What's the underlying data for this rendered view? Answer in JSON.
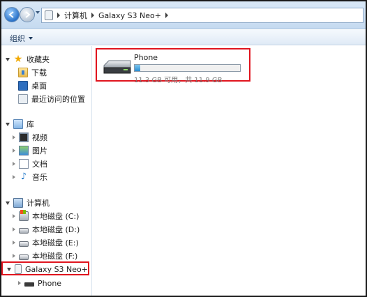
{
  "address_bar": {
    "crumbs": [
      "计算机",
      "Galaxy S3 Neo+"
    ]
  },
  "toolbar": {
    "organize_label": "组织"
  },
  "navpane": {
    "favorites": {
      "label": "收藏夹",
      "items": [
        "下载",
        "桌面",
        "最近访问的位置"
      ]
    },
    "libraries": {
      "label": "库",
      "items": [
        "视频",
        "图片",
        "文档",
        "音乐"
      ]
    },
    "computer": {
      "label": "计算机",
      "drives": [
        "本地磁盘 (C:)",
        "本地磁盘 (D:)",
        "本地磁盘 (E:)",
        "本地磁盘 (F:)"
      ],
      "device": "Galaxy S3 Neo+",
      "device_child": "Phone"
    }
  },
  "content": {
    "storage": {
      "name": "Phone",
      "free": "11.3 GB 可用，共 11.9 GB",
      "used_fraction": 0.05
    }
  },
  "colors": {
    "highlight_red": "#e0141e",
    "bar_fill": "#2a8fd3"
  }
}
